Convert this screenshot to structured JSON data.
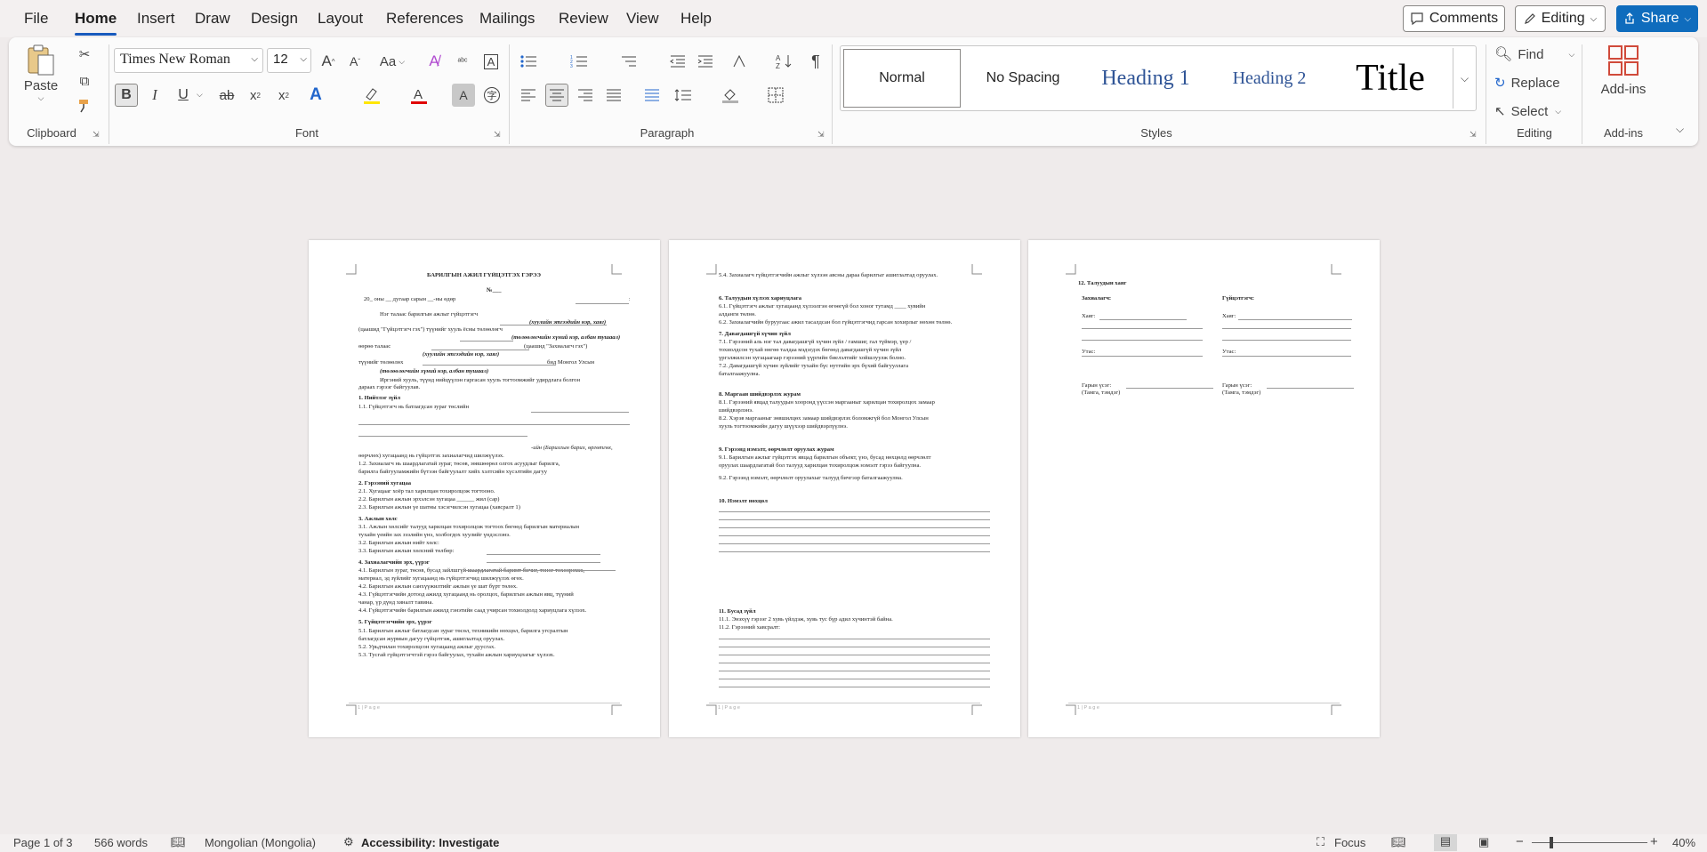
{
  "menu": {
    "file": "File",
    "home": "Home",
    "insert": "Insert",
    "draw": "Draw",
    "design": "Design",
    "layout": "Layout",
    "references": "References",
    "mailings": "Mailings",
    "review": "Review",
    "view": "View",
    "help": "Help"
  },
  "top": {
    "comments": "Comments",
    "editing": "Editing",
    "share": "Share"
  },
  "ribbon": {
    "clipboard": {
      "label": "Clipboard",
      "paste": "Paste"
    },
    "font": {
      "label": "Font",
      "name": "Times New Roman",
      "size": "12",
      "bold": "B",
      "italic": "I",
      "underline": "U",
      "strike": "ab",
      "sub": "x",
      "sup": "x",
      "grow": "A",
      "shrink": "A",
      "case": "Aa"
    },
    "paragraph": {
      "label": "Paragraph"
    },
    "styles": {
      "label": "Styles",
      "normal": "Normal",
      "nospacing": "No Spacing",
      "h1": "Heading 1",
      "h2": "Heading 2",
      "title": "Title"
    },
    "editing": {
      "label": "Editing",
      "find": "Find",
      "replace": "Replace",
      "select": "Select"
    },
    "addins": {
      "label": "Add-ins",
      "btn": "Add-ins"
    }
  },
  "status": {
    "page": "Page 1 of 3",
    "words": "566 words",
    "language": "Mongolian (Mongolia)",
    "accessibility": "Accessibility: Investigate",
    "focus": "Focus",
    "zoom": "40%"
  },
  "pages": {
    "footer": "1 | P a g e",
    "p1": [
      "БАРИЛГЫН АЖИЛ ГҮЙЦЭТГЭХ ГЭРЭЭ",
      "№___",
      "20_ оны __ дугаар сарын __-ны өдөр",
      "хот",
      "Нэг талаас барилгын ажлыг гүйцэтгэгч",
      "(хуулийн этгээдийн нэр, хаяг)",
      "(цаашид \"Гүйцэтгэгч гэх\") түүнийг хууль ёсны төлөөлөгч",
      "(төлөөлөгчийн хүний нэр, албан тушаал)",
      "өөрөө талаас",
      "(цаашид \"Захиалагч гэх\")",
      "(хуулийн этгээдийн нэр, хаяг)",
      "түүнийг төлөөлөх",
      "бид Монгол Улсын",
      "(төлөөлөгчийн хүний нэр, албан тушаал)",
      "Иргэний хууль, түүнд нийцүүлэн гаргасан хууль тогтоомжийг удирдлага болгон",
      "дараах гэрээг байгуулав.",
      "1. Нийтлэг зүйл",
      "1.1. Гүйцэтгэгч нь батлагдсан зураг төслийн",
      "-ийн (Барилгын барих, өргөтгөх,",
      "өөрчлөх) хугацаанд нь гүйцэтгэх захиалагчид шилжүүлэх.",
      "1.2. Захиалагч нь шаардлагатай зураг, төсөв, зөвшөөрөл олгох асуудлыг барилга,",
      "барилга байгууламжийн бүтээн байгуулалт хийх хэлтсийн хүсэлтийн дагуу",
      "2. Гэрээний хугацаа",
      "2.1. Хугацааг хоёр тал харилцан тохиролцож тогтооно.",
      "2.2. Барилгын ажлын эрхэлсэн хугацаа ______ жил (сар)",
      "2.3. Барилгын ажлын үе шатны хэсэгчилсэн хугацаа (хавсралт 1)",
      "3. Ажлын хөлс",
      "3.1. Ажлын хөлсийг талууд харилцан тохиролцож тогтоох бөгөөд барилгын материалын",
      "тухайн үеийн зах зээлийн үнэ, холбогдох хуулийг үндэслэнэ.",
      "3.2. Барилгын ажлын нийт хөлс:",
      "3.3. Барилгын ажлын хөлсний төлбөр:",
      "4. Захиалагчийн эрх, үүрэг",
      "4.1. Барилгын зураг, төсөв, бусад зайлшгүй шаардлагатай баримт бичиг, тоног төхөөрөмж,",
      "материал, эд зүйлийг хугацаанд нь гүйцэтгэгчид шилжүүлэх өгөх.",
      "4.2. Барилгын ажлын санхүүжилтийг ажлын үе шат бүрт төлөх.",
      "4.3. Гүйцэтгэгчийн дотоод ажилд хугацаанд нь оролцох, барилгын ажлын явц, түүний",
      "чанар, үр дүнд хяналт тавина.",
      "4.4. Гүйцэтгэгчийн барилгын ажилд гэнэтийн саад учирсан тохиолдолд хариуцлага хүлээх.",
      "5. Гүйцэтгэгчийн эрх, үүрэг",
      "5.1. Барилгын ажлыг батлагдсан зураг төсөл, техникийн нөхцөл, барилга угсралтын",
      "батлагдсан журмын дагуу гүйцэтгэж, ашиглалтад оруулах.",
      "5.2. Урьдчилан тохиролцсон хугацаанд ажлыг дуусгах.",
      "5.3. Тусгай гүйцэтгэгчтэй гэрээ байгуулах, тухайн ажлын хариуцлагыг хүлээх."
    ],
    "p2": [
      "5.4. Захиалагч гүйцэтгэгчийн ажлыг хүлээн авсны дараа барилгыг ашиглалтад оруулах.",
      "6. Талуудын хүлээх хариуцлага",
      "6.1. Гүйцэтгэгч ажлыг хугацаанд хүлээлгэн өгөөгүй бол хоног тутамд ____ хувийн",
      "алданги төлнө.",
      "6.2. Захиалагчийн буруугаас ажил тасалдсан бол гүйцэтгэгчид гарсан хохирлыг нөхөн төлнө.",
      "7. Давагдашгүй хүчин зүйл",
      "7.1. Гэрээний аль нэг тал давагдашгүй хүчин зүйл / гамшиг, гал түймэр, үер /",
      "тохиолдсон тухай нөгөө талдаа мэдэгдэх бөгөөд давагдашгүй хүчин зүйл",
      "үргэлжилсэн хугацаагаар гэрээний үүргийн биелэлтийг хойшлуулж болно.",
      "7.2. Давагдашгүй хүчин зүйлийг тухайн бүс нутгийн эрх бүхий байгууллага",
      "баталгаажуулна.",
      "8. Маргаан шийдвэрлэх журам",
      "8.1. Гэрээний явцад талуудын хооронд үүссэн маргааныг харилцан тохиролцох замаар",
      "шийдвэрлэнэ.",
      "8.2. Хэрэв маргааныг зөвшилцөх замаар шийдвэрлэх боломжгүй бол Монгол Улсын",
      "хууль тогтоомжийн дагуу шүүхээр шийдвэрлүүлнэ.",
      "9. Гэрээнд нэмэлт, өөрчлөлт оруулах журам",
      "9.1. Барилгын ажлыг гүйцэтгэх явцад барилгын объект, үнэ, бусад нөхцөлд өөрчлөлт",
      "оруулах шаардлагатай бол талууд харилцан тохиролцож нэмэлт гэрээ байгуулна.",
      "9.2. Гэрээнд нэмэлт, өөрчлөлт оруулахыг талууд бичгээр баталгаажуулна.",
      "10. Нэмэлт нөхцөл",
      "11. Бусад зүйл",
      "11.1. Энэхүү гэрээг 2 хувь үйлдэж, хувь тус бүр адил хүчинтэй байна.",
      "11.2. Гэрээний хавсралт:"
    ],
    "p3": [
      "12. Талуудын хаяг",
      "Захиалагч:",
      "Гүйцэтгэгч:",
      "Хаяг:",
      "Хаяг:",
      "Утас:",
      "Утас:",
      "Гарын үсэг:",
      "Гарын үсэг:",
      "(Тамга, тэмдэг)",
      "(Тамга, тэмдэг)"
    ]
  }
}
